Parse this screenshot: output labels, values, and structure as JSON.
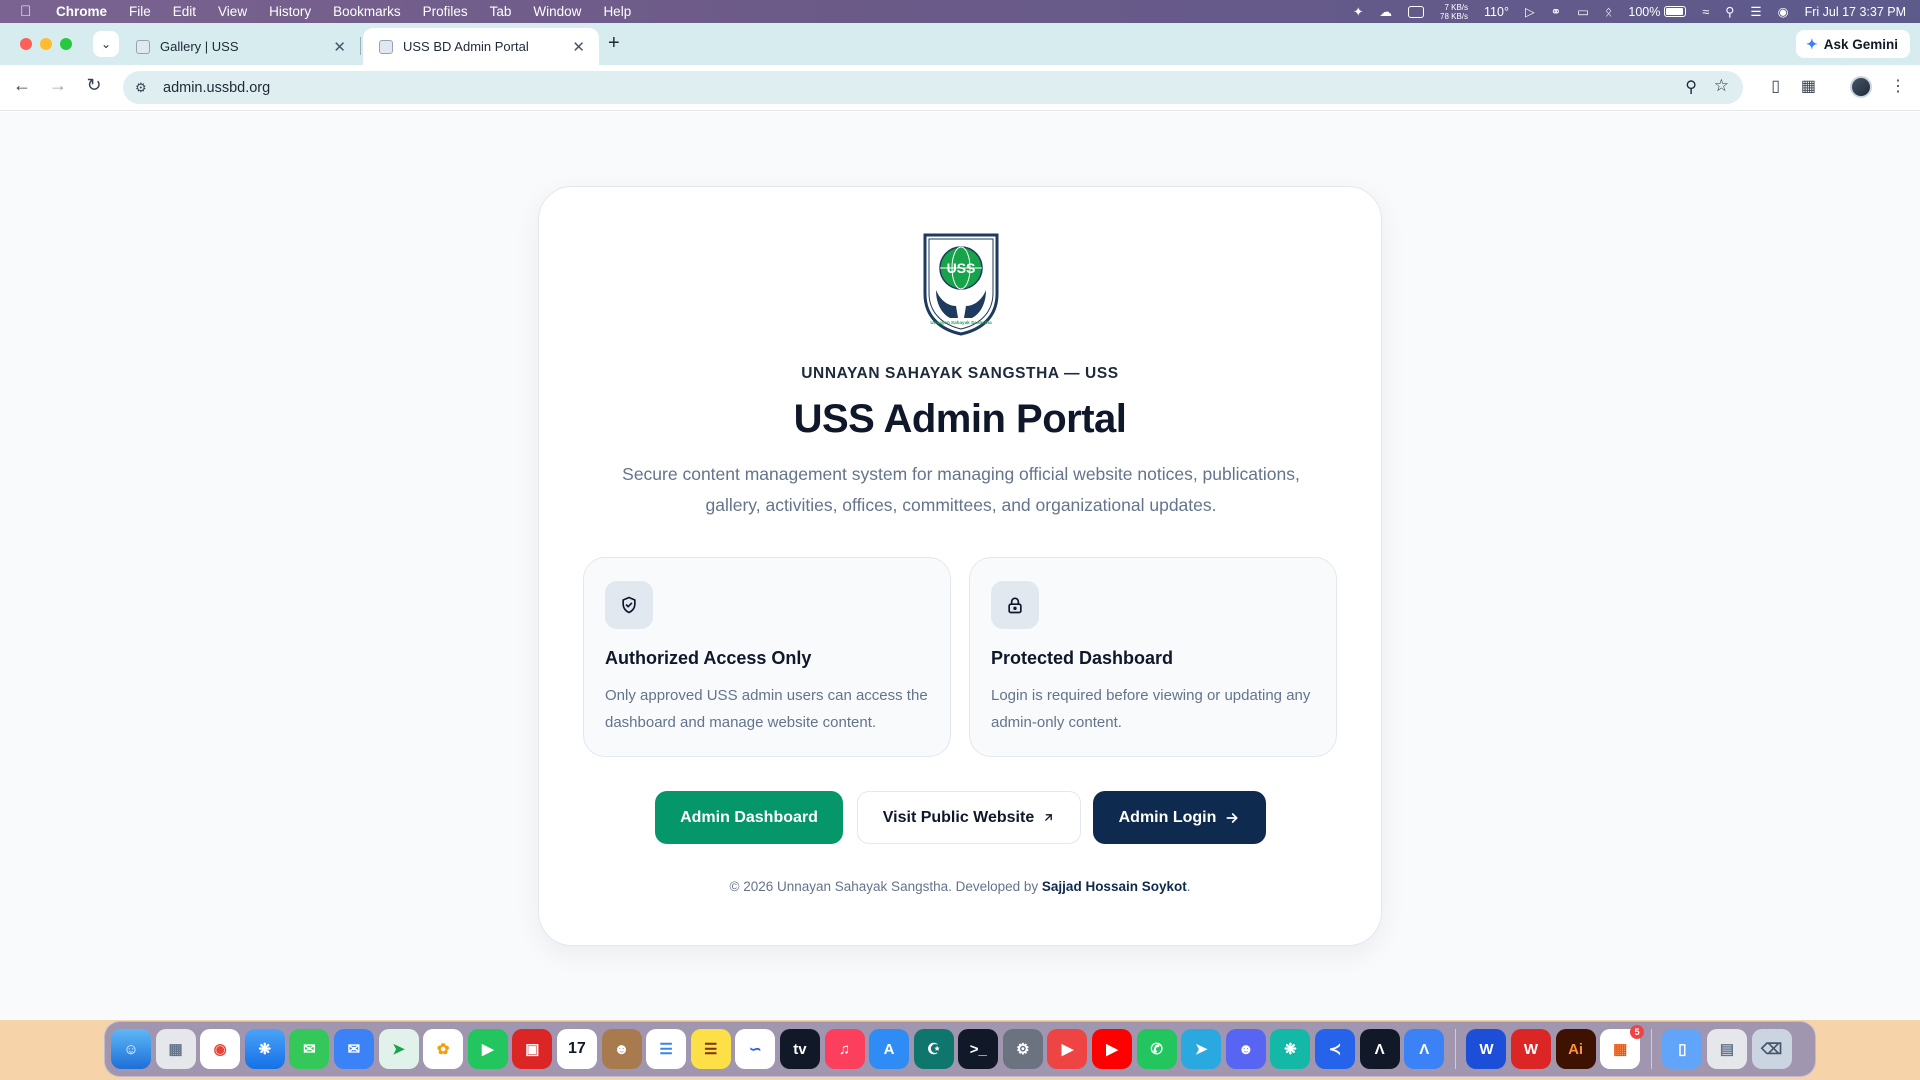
{
  "menubar": {
    "app": "Chrome",
    "items": [
      "File",
      "Edit",
      "View",
      "History",
      "Bookmarks",
      "Profiles",
      "Tab",
      "Window",
      "Help"
    ],
    "net_up": "7 KB/s",
    "net_down": "78 KB/s",
    "temperature": "110°",
    "battery": "100%",
    "datetime": "Fri Jul 17  3:37 PM"
  },
  "browser": {
    "tabs": [
      {
        "title": "Gallery | USS",
        "active": false
      },
      {
        "title": "USS BD Admin Portal",
        "active": true
      }
    ],
    "gemini_label": "Ask Gemini",
    "url": "admin.ussbd.org"
  },
  "page": {
    "logo": {
      "text": "USS",
      "caption": "Unnayan Sahayak Sangstha"
    },
    "eyebrow": "UNNAYAN SAHAYAK SANGSTHA — USS",
    "title": "USS Admin Portal",
    "subtitle": "Secure content management system for managing official website notices, publications, gallery, activities, offices, committees, and organizational updates.",
    "features": [
      {
        "icon": "shield-check-icon",
        "title": "Authorized Access Only",
        "description": "Only approved USS admin users can access the dashboard and manage website content."
      },
      {
        "icon": "lock-icon",
        "title": "Protected Dashboard",
        "description": "Login is required before viewing or updating any admin-only content."
      }
    ],
    "buttons": {
      "dashboard": "Admin Dashboard",
      "public": "Visit Public Website",
      "login": "Admin Login"
    },
    "footer": {
      "prefix": "© 2026 Unnayan Sahayak Sangstha. Developed by ",
      "author": "Sajjad Hossain Soykot",
      "suffix": "."
    }
  },
  "dock": {
    "badge_count": "5"
  },
  "colors": {
    "primary_green": "#059669",
    "navy": "#0f2a4f",
    "slate_text": "#64748b"
  }
}
